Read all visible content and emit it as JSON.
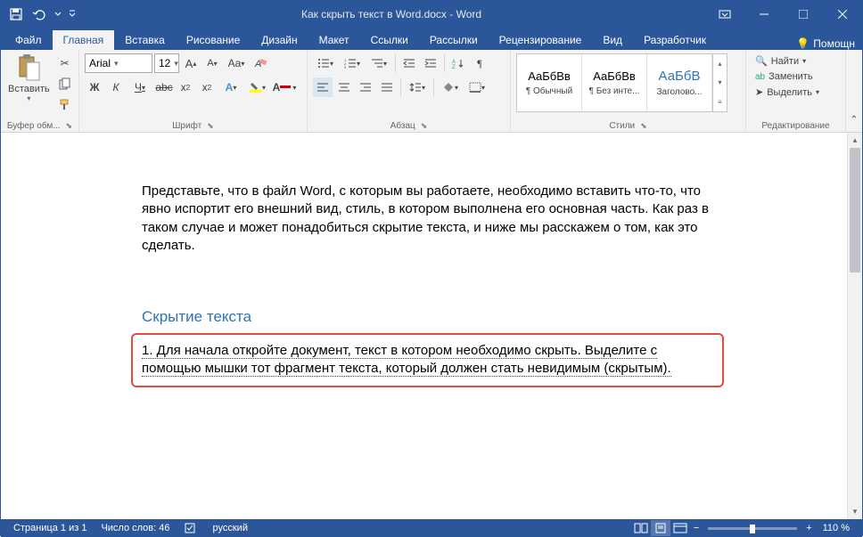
{
  "titlebar": {
    "title": "Как скрыть текст в Word.docx - Word"
  },
  "tabs": {
    "file": "Файл",
    "home": "Главная",
    "insert": "Вставка",
    "draw": "Рисование",
    "design": "Дизайн",
    "layout": "Макет",
    "references": "Ссылки",
    "mailings": "Рассылки",
    "review": "Рецензирование",
    "view": "Вид",
    "developer": "Разработчик",
    "help": "Помощн"
  },
  "ribbon": {
    "clipboard": {
      "label": "Буфер обм...",
      "paste": "Вставить"
    },
    "font": {
      "label": "Шрифт",
      "name": "Arial",
      "size": "12",
      "bold": "Ж",
      "italic": "К",
      "underline": "Ч"
    },
    "paragraph": {
      "label": "Абзац"
    },
    "styles": {
      "label": "Стили",
      "items": [
        {
          "preview": "АаБбВв",
          "name": "¶ Обычный"
        },
        {
          "preview": "АаБбВв",
          "name": "¶ Без инте..."
        },
        {
          "preview": "АаБбВ",
          "name": "Заголово..."
        }
      ]
    },
    "editing": {
      "label": "Редактирование",
      "find": "Найти",
      "replace": "Заменить",
      "select": "Выделить"
    }
  },
  "document": {
    "paragraph1": "Представьте, что в файл Word, с которым вы работаете, необходимо вставить что-то, что явно испортит его внешний вид, стиль, в котором выполнена его основная часть. Как раз в таком случае и может понадобиться скрытие текста, и ниже мы расскажем о том, как это сделать.",
    "heading": "Скрытие текста",
    "step1": "1. Для начала откройте документ, текст в котором необходимо скрыть. Выделите с помощью мышки тот фрагмент текста, который должен стать невидимым (скрытым)."
  },
  "statusbar": {
    "page": "Страница 1 из 1",
    "words": "Число слов: 46",
    "language": "русский",
    "zoom": "110 %"
  }
}
